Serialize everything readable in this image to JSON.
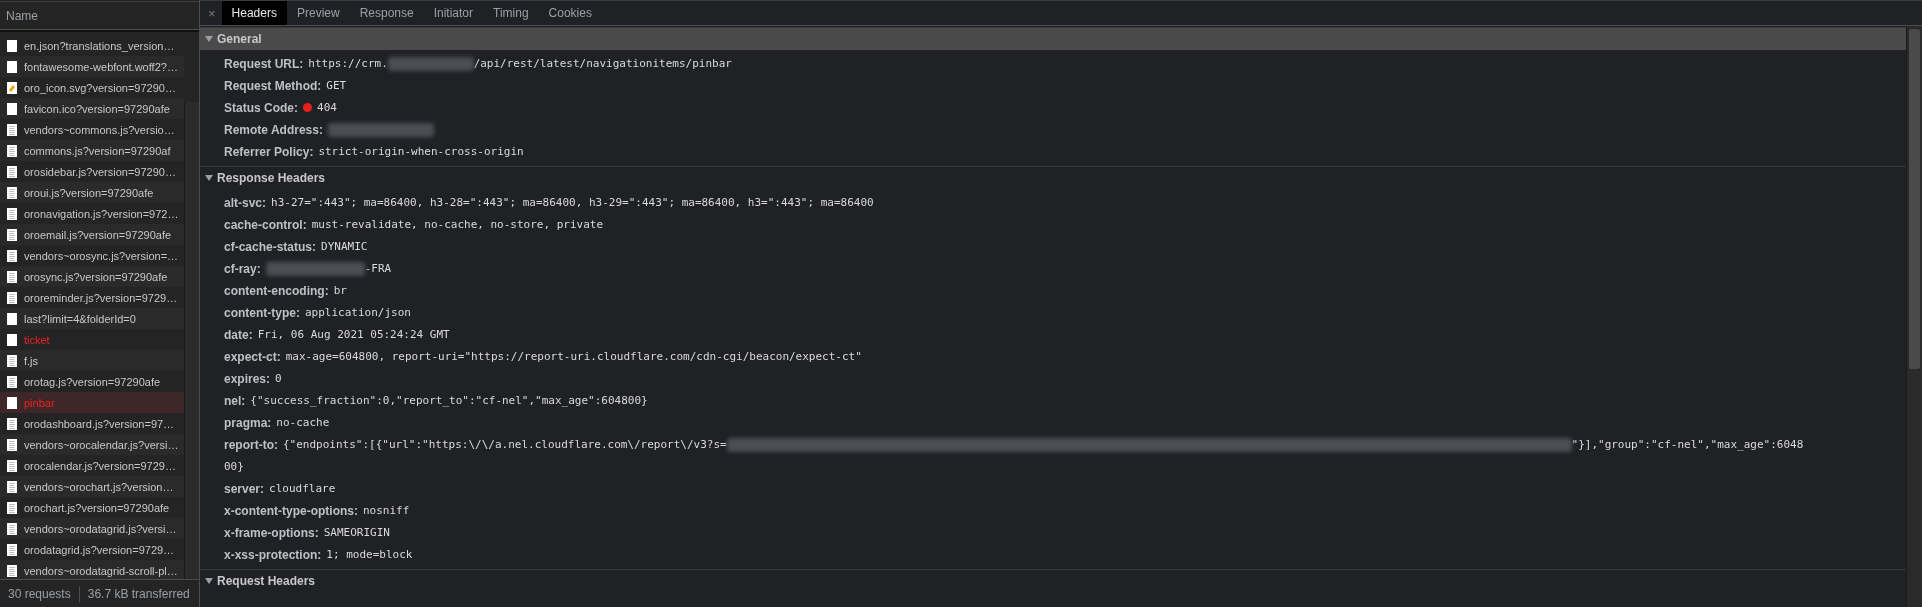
{
  "requests": {
    "column": "Name",
    "items": [
      {
        "name": "en.json?translations_version…",
        "kind": "blank",
        "error": false,
        "selected": false
      },
      {
        "name": "fontawesome-webfont.woff2?…",
        "kind": "blank",
        "error": false,
        "selected": false
      },
      {
        "name": "oro_icon.svg?version=97290…",
        "kind": "image",
        "error": false,
        "selected": false
      },
      {
        "name": "favicon.ico?version=97290afe",
        "kind": "blank",
        "error": false,
        "selected": false
      },
      {
        "name": "vendors~commons.js?versio…",
        "kind": "script",
        "error": false,
        "selected": false
      },
      {
        "name": "commons.js?version=97290af",
        "kind": "script",
        "error": false,
        "selected": false
      },
      {
        "name": "orosidebar.js?version=97290…",
        "kind": "script",
        "error": false,
        "selected": false
      },
      {
        "name": "oroui.js?version=97290afe",
        "kind": "script",
        "error": false,
        "selected": false
      },
      {
        "name": "oronavigation.js?version=972…",
        "kind": "script",
        "error": false,
        "selected": false
      },
      {
        "name": "oroemail.js?version=97290afe",
        "kind": "script",
        "error": false,
        "selected": false
      },
      {
        "name": "vendors~orosync.js?version=…",
        "kind": "script",
        "error": false,
        "selected": false
      },
      {
        "name": "orosync.js?version=97290afe",
        "kind": "script",
        "error": false,
        "selected": false
      },
      {
        "name": "ororeminder.js?version=9729…",
        "kind": "script",
        "error": false,
        "selected": false
      },
      {
        "name": "last?limit=4&folderId=0",
        "kind": "blank",
        "error": false,
        "selected": false
      },
      {
        "name": "ticket",
        "kind": "blank",
        "error": true,
        "selected": false
      },
      {
        "name": "f.js",
        "kind": "script",
        "error": false,
        "selected": false
      },
      {
        "name": "orotag.js?version=97290afe",
        "kind": "script",
        "error": false,
        "selected": false
      },
      {
        "name": "pinbar",
        "kind": "blank",
        "error": true,
        "selected": true
      },
      {
        "name": "orodashboard.js?version=97…",
        "kind": "script",
        "error": false,
        "selected": false
      },
      {
        "name": "vendors~orocalendar.js?versi…",
        "kind": "script",
        "error": false,
        "selected": false
      },
      {
        "name": "orocalendar.js?version=9729…",
        "kind": "script",
        "error": false,
        "selected": false
      },
      {
        "name": "vendors~orochart.js?version…",
        "kind": "script",
        "error": false,
        "selected": false
      },
      {
        "name": "orochart.js?version=97290afe",
        "kind": "script",
        "error": false,
        "selected": false
      },
      {
        "name": "vendors~orodatagrid.js?versi…",
        "kind": "script",
        "error": false,
        "selected": false
      },
      {
        "name": "orodatagrid.js?version=9729…",
        "kind": "script",
        "error": false,
        "selected": false
      },
      {
        "name": "vendors~orodatagrid-scroll-pl…",
        "kind": "script",
        "error": false,
        "selected": false
      }
    ],
    "status_bar": [
      "30 requests",
      "36.7 kB transferred"
    ]
  },
  "details": {
    "close": "×",
    "tabs": [
      {
        "label": "Headers",
        "selected": true
      },
      {
        "label": "Preview",
        "selected": false
      },
      {
        "label": "Response",
        "selected": false
      },
      {
        "label": "Initiator",
        "selected": false
      },
      {
        "label": "Timing",
        "selected": false
      },
      {
        "label": "Cookies",
        "selected": false
      }
    ],
    "sections": [
      {
        "title": "General",
        "expanded": true,
        "highlighted": true,
        "rows": [
          {
            "label": "Request URL:",
            "parts": [
              {
                "kind": "text",
                "text": "https://crm."
              },
              {
                "kind": "redacted"
              },
              {
                "kind": "text",
                "text": "/api/rest/latest/navigationitems/pinbar"
              }
            ]
          },
          {
            "label": "Request Method:",
            "parts": [
              {
                "kind": "text",
                "text": "GET"
              }
            ]
          },
          {
            "label": "Status Code:",
            "parts": [
              {
                "kind": "status",
                "color": "#e8201b"
              },
              {
                "kind": "text",
                "text": "404"
              }
            ]
          },
          {
            "label": "Remote Address:",
            "parts": [
              {
                "kind": "redacted"
              }
            ]
          },
          {
            "label": "Referrer Policy:",
            "parts": [
              {
                "kind": "text",
                "text": "strict-origin-when-cross-origin"
              }
            ]
          }
        ]
      },
      {
        "title": "Response Headers",
        "expanded": true,
        "highlighted": false,
        "rows": [
          {
            "label": "alt-svc:",
            "parts": [
              {
                "kind": "text",
                "text": "h3-27=\":443\"; ma=86400, h3-28=\":443\"; ma=86400, h3-29=\":443\"; ma=86400, h3=\":443\"; ma=86400"
              }
            ]
          },
          {
            "label": "cache-control:",
            "parts": [
              {
                "kind": "text",
                "text": "must-revalidate, no-cache, no-store, private"
              }
            ]
          },
          {
            "label": "cf-cache-status:",
            "parts": [
              {
                "kind": "text",
                "text": "DYNAMIC"
              }
            ]
          },
          {
            "label": "cf-ray:",
            "parts": [
              {
                "kind": "redacted"
              },
              {
                "kind": "text",
                "text": "-FRA"
              }
            ]
          },
          {
            "label": "content-encoding:",
            "parts": [
              {
                "kind": "text",
                "text": "br"
              }
            ]
          },
          {
            "label": "content-type:",
            "parts": [
              {
                "kind": "text",
                "text": "application/json"
              }
            ]
          },
          {
            "label": "date:",
            "parts": [
              {
                "kind": "text",
                "text": "Fri, 06 Aug 2021 05:24:24 GMT"
              }
            ]
          },
          {
            "label": "expect-ct:",
            "parts": [
              {
                "kind": "text",
                "text": "max-age=604800, report-uri=\"https://report-uri.cloudflare.com/cdn-cgi/beacon/expect-ct\""
              }
            ]
          },
          {
            "label": "expires:",
            "parts": [
              {
                "kind": "text",
                "text": "0"
              }
            ]
          },
          {
            "label": "nel:",
            "parts": [
              {
                "kind": "text",
                "text": "{\"success_fraction\":0,\"report_to\":\"cf-nel\",\"max_age\":604800}"
              }
            ]
          },
          {
            "label": "pragma:",
            "parts": [
              {
                "kind": "text",
                "text": "no-cache"
              }
            ]
          },
          {
            "label": "report-to:",
            "parts": [
              {
                "kind": "text",
                "text": "{\"endpoints\":[{\"url\":\"https:\\/\\/a.nel.cloudflare.com\\/report\\/v3?s="
              },
              {
                "kind": "redacted"
              },
              {
                "kind": "text",
                "text": "\"}],\"group\":\"cf-nel\",\"max_age\":6048"
              },
              {
                "kind": "break"
              },
              {
                "kind": "text",
                "text": "00}"
              }
            ]
          },
          {
            "label": "server:",
            "parts": [
              {
                "kind": "text",
                "text": "cloudflare"
              }
            ]
          },
          {
            "label": "x-content-type-options:",
            "parts": [
              {
                "kind": "text",
                "text": "nosniff"
              }
            ]
          },
          {
            "label": "x-frame-options:",
            "parts": [
              {
                "kind": "text",
                "text": "SAMEORIGIN"
              }
            ]
          },
          {
            "label": "x-xss-protection:",
            "parts": [
              {
                "kind": "text",
                "text": "1; mode=block"
              }
            ]
          }
        ]
      },
      {
        "title": "Request Headers",
        "expanded": true,
        "highlighted": false
      }
    ]
  }
}
